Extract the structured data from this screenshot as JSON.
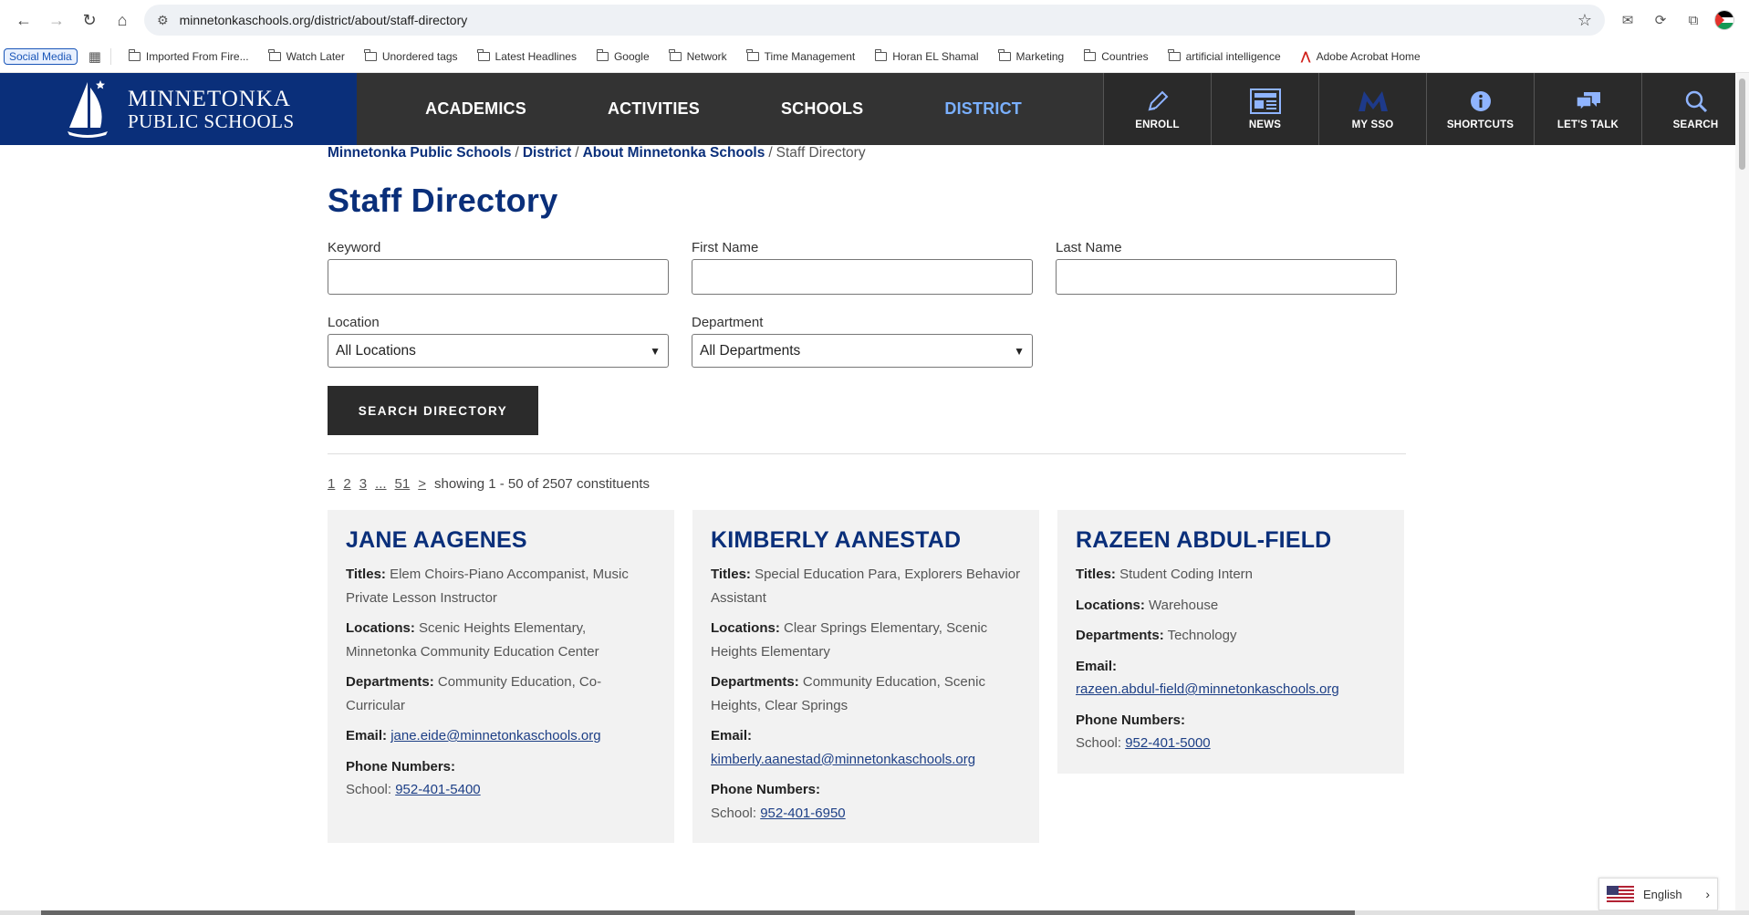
{
  "browser": {
    "url": "minnetonkaschools.org/district/about/staff-directory",
    "bookmarks": {
      "pill": "Social Media",
      "items": [
        "Imported From Fire...",
        "Watch Later",
        "Unordered tags",
        "Latest Headlines",
        "Google",
        "Network",
        "Time Management",
        "Horan EL Shamal",
        "Marketing",
        "Countries",
        "artificial intelligence"
      ],
      "acrobat": "Adobe Acrobat Home"
    }
  },
  "header": {
    "logo_line1": "MINNETONKA",
    "logo_line2": "PUBLIC SCHOOLS",
    "nav": [
      "ACADEMICS",
      "ACTIVITIES",
      "SCHOOLS",
      "DISTRICT"
    ],
    "active_nav": "DISTRICT",
    "utility": [
      "ENROLL",
      "NEWS",
      "MY SSO",
      "SHORTCUTS",
      "LET'S TALK",
      "SEARCH"
    ]
  },
  "breadcrumb": {
    "items": [
      "Minnetonka Public Schools",
      "District",
      "About Minnetonka Schools"
    ],
    "current": "Staff Directory"
  },
  "page_title": "Staff Directory",
  "form": {
    "keyword_label": "Keyword",
    "first_name_label": "First Name",
    "last_name_label": "Last Name",
    "location_label": "Location",
    "location_value": "All Locations",
    "department_label": "Department",
    "department_value": "All Departments",
    "search_button": "SEARCH DIRECTORY"
  },
  "pager": {
    "pages": [
      "1",
      "2",
      "3",
      "...",
      "51",
      ">"
    ],
    "summary": "showing 1 - 50 of 2507 constituents"
  },
  "labels": {
    "titles": "Titles:",
    "locations": "Locations:",
    "departments": "Departments:",
    "email": "Email:",
    "phone_numbers": "Phone Numbers:",
    "school": "School:"
  },
  "staff": [
    {
      "name": "JANE AAGENES",
      "titles": "Elem Choirs-Piano Accompanist, Music Private Lesson Instructor",
      "locations": "Scenic Heights Elementary, Minnetonka Community Education Center",
      "departments": "Community Education, Co-Curricular",
      "email": "jane.eide@minnetonkaschools.org",
      "phone": "952-401-5400"
    },
    {
      "name": "KIMBERLY AANESTAD",
      "titles": "Special Education Para, Explorers Behavior Assistant",
      "locations": "Clear Springs Elementary, Scenic Heights Elementary",
      "departments": "Community Education, Scenic Heights, Clear Springs",
      "email": "kimberly.aanestad@minnetonkaschools.org",
      "phone": "952-401-6950"
    },
    {
      "name": "RAZEEN ABDUL-FIELD",
      "titles": "Student Coding Intern",
      "locations": "Warehouse",
      "departments": "Technology",
      "email": "razeen.abdul-field@minnetonkaschools.org",
      "phone": "952-401-5000"
    }
  ],
  "language": "English"
}
